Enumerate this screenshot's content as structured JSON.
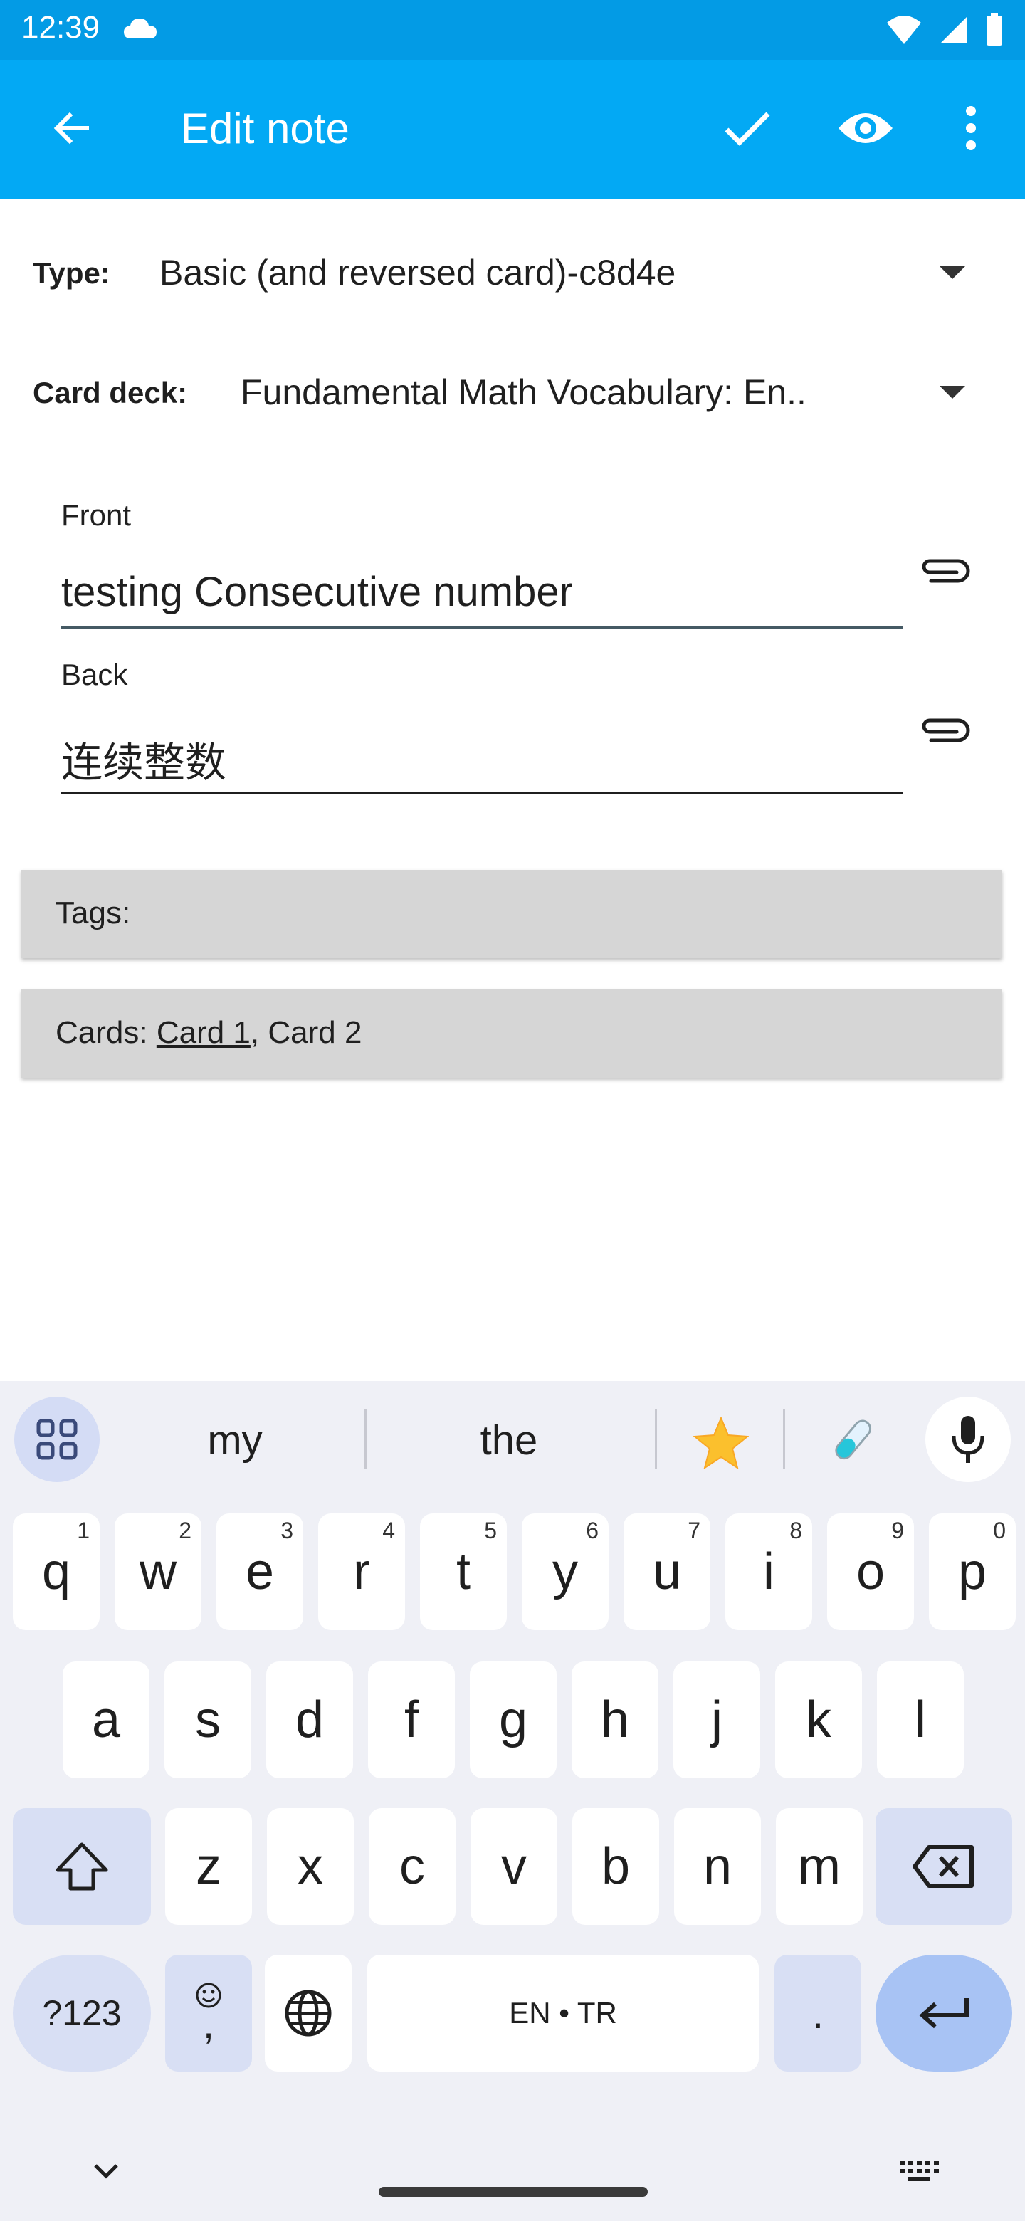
{
  "status_bar": {
    "time": "12:39"
  },
  "app_bar": {
    "title": "Edit note"
  },
  "type_row": {
    "label": "Type:",
    "value": "Basic (and reversed card)-c8d4e"
  },
  "deck_row": {
    "label": "Card deck:",
    "value": "Fundamental Math Vocabulary: En.."
  },
  "fields": {
    "front": {
      "label": "Front",
      "value": "testing Consecutive number"
    },
    "back": {
      "label": "Back",
      "value": "连续整数"
    }
  },
  "tags": {
    "label": "Tags:"
  },
  "cards": {
    "label": "Cards: ",
    "card1": "Card 1",
    "separator": ", ",
    "card2": "Card 2"
  },
  "keyboard": {
    "suggestions": [
      "my",
      "the"
    ],
    "row1": [
      {
        "k": "q",
        "h": "1"
      },
      {
        "k": "w",
        "h": "2"
      },
      {
        "k": "e",
        "h": "3"
      },
      {
        "k": "r",
        "h": "4"
      },
      {
        "k": "t",
        "h": "5"
      },
      {
        "k": "y",
        "h": "6"
      },
      {
        "k": "u",
        "h": "7"
      },
      {
        "k": "i",
        "h": "8"
      },
      {
        "k": "o",
        "h": "9"
      },
      {
        "k": "p",
        "h": "0"
      }
    ],
    "row2": [
      "a",
      "s",
      "d",
      "f",
      "g",
      "h",
      "j",
      "k",
      "l"
    ],
    "row3": [
      "z",
      "x",
      "c",
      "v",
      "b",
      "n",
      "m"
    ],
    "symbols_label": "?123",
    "comma_label": ",",
    "space_label": "EN • TR",
    "period_label": "."
  },
  "colors": {
    "status_bar": "#039be5",
    "app_bar": "#03a9f4",
    "keyboard_bg": "#eff0f6",
    "special_key": "#d8dff4"
  }
}
